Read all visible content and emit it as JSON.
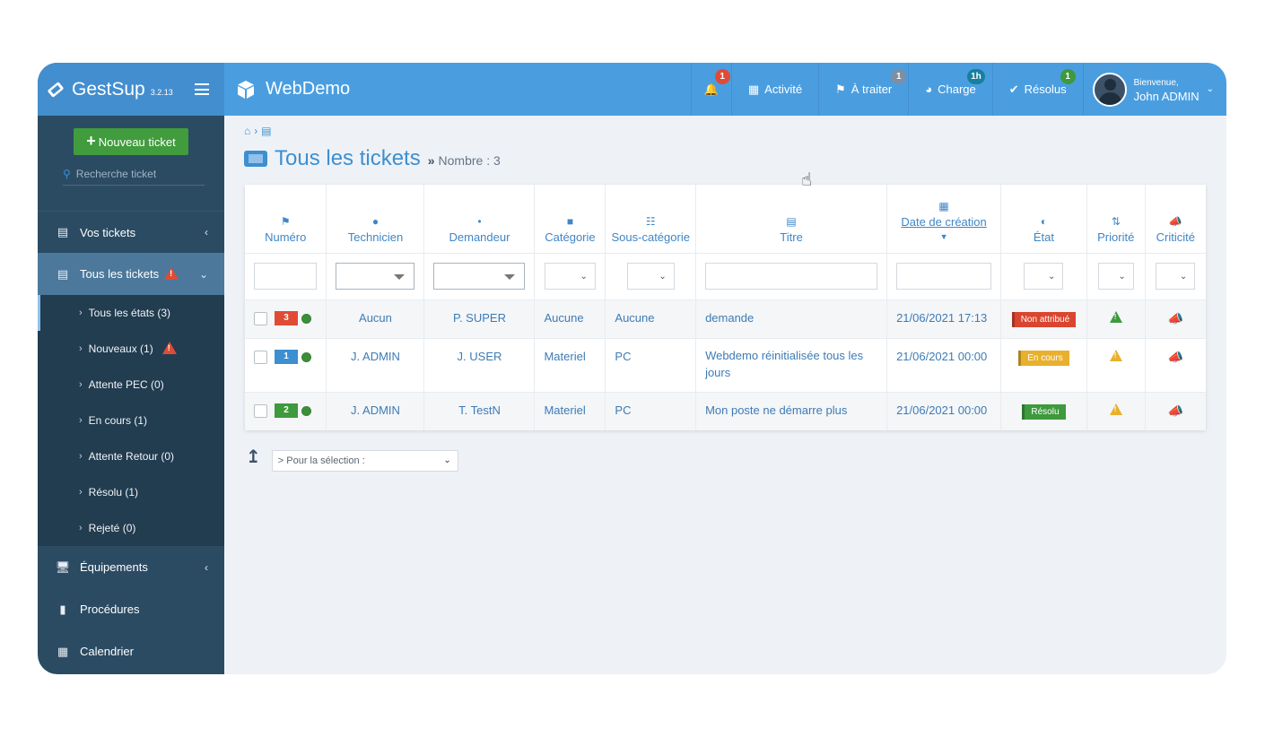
{
  "app": {
    "brand": "GestSup",
    "version": "3.2.13",
    "site": "WebDemo"
  },
  "topbar": {
    "notifications_badge": "1",
    "activity_label": "Activité",
    "to_process_label": "À traiter",
    "to_process_badge": "1",
    "load_label": "Charge",
    "load_badge": "1h",
    "resolved_label": "Résolus",
    "resolved_badge": "1",
    "welcome": "Bienvenue,",
    "user_name": "John ADMIN"
  },
  "sidebar": {
    "new_ticket": "Nouveau ticket",
    "search_placeholder": "Recherche ticket",
    "your_tickets": "Vos tickets",
    "all_tickets": "Tous les tickets",
    "states": [
      {
        "label": "Tous les états (3)"
      },
      {
        "label": "Nouveaux (1)"
      },
      {
        "label": "Attente PEC (0)"
      },
      {
        "label": "En cours (1)"
      },
      {
        "label": "Attente Retour (0)"
      },
      {
        "label": "Résolu (1)"
      },
      {
        "label": "Rejeté (0)"
      }
    ],
    "equipment": "Équipements",
    "procedures": "Procédures",
    "calendar": "Calendrier"
  },
  "page": {
    "title": "Tous les tickets",
    "count_label": "Nombre : 3"
  },
  "table": {
    "columns": [
      "Numéro",
      "Technicien",
      "Demandeur",
      "Catégorie",
      "Sous-catégorie",
      "Titre",
      "Date de création",
      "État",
      "Priorité",
      "Criticité"
    ],
    "rows": [
      {
        "number": "3",
        "number_color": "#e04b35",
        "technician": "Aucun",
        "requester": "P. SUPER",
        "category": "Aucune",
        "subcategory": "Aucune",
        "title": "demande",
        "created": "21/06/2021 17:13",
        "state": "Non attribué",
        "state_color": "#d9452f",
        "priority_color": "#3e9a3c",
        "criticity_color": "#3e9a3c"
      },
      {
        "number": "1",
        "number_color": "#3c8fd0",
        "technician": "J. ADMIN",
        "requester": "J. USER",
        "category": "Materiel",
        "subcategory": "PC",
        "title": "Webdemo réinitialisée tous les jours",
        "created": "21/06/2021 00:00",
        "state": "En cours",
        "state_color": "#e8b02d",
        "priority_color": "#e8b02d",
        "criticity_color": "#d9452f"
      },
      {
        "number": "2",
        "number_color": "#3e9a3c",
        "technician": "J. ADMIN",
        "requester": "T. TestN",
        "category": "Materiel",
        "subcategory": "PC",
        "title": "Mon poste ne démarre plus",
        "created": "21/06/2021 00:00",
        "state": "Résolu",
        "state_color": "#3e9a3c",
        "priority_color": "#e8b02d",
        "criticity_color": "#3e9a3c"
      }
    ]
  },
  "bulk": {
    "select_label": "> Pour la sélection :"
  }
}
